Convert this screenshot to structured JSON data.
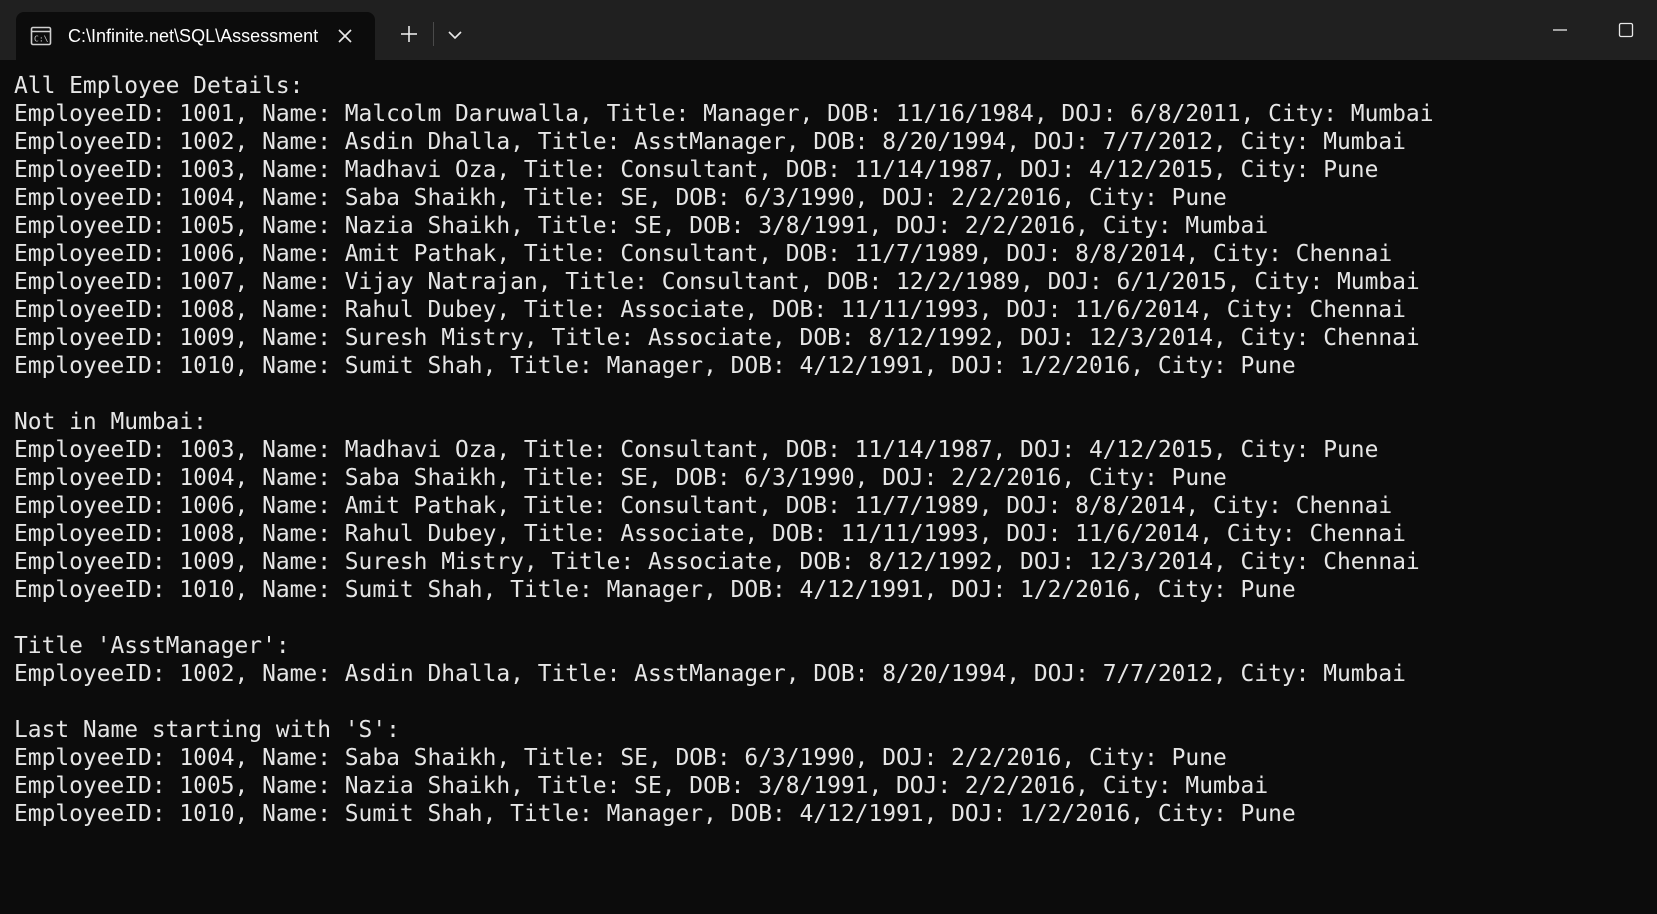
{
  "window": {
    "tab_title": "C:\\Infinite.net\\SQL\\Assessment",
    "tab_icon": "console-icon",
    "new_tab_icon": "plus-icon",
    "dropdown_icon": "chevron-down-icon",
    "minimize_icon": "minimize-icon",
    "maximize_icon": "maximize-icon",
    "close_icon": "close-icon"
  },
  "colors": {
    "background": "#0c0c0c",
    "titlebar": "#202020",
    "text": "#e6e6e6"
  },
  "console": {
    "sections": [
      {
        "heading": "All Employee Details:",
        "lines": [
          "EmployeeID: 1001, Name: Malcolm Daruwalla, Title: Manager, DOB: 11/16/1984, DOJ: 6/8/2011, City: Mumbai",
          "EmployeeID: 1002, Name: Asdin Dhalla, Title: AsstManager, DOB: 8/20/1994, DOJ: 7/7/2012, City: Mumbai",
          "EmployeeID: 1003, Name: Madhavi Oza, Title: Consultant, DOB: 11/14/1987, DOJ: 4/12/2015, City: Pune",
          "EmployeeID: 1004, Name: Saba Shaikh, Title: SE, DOB: 6/3/1990, DOJ: 2/2/2016, City: Pune",
          "EmployeeID: 1005, Name: Nazia Shaikh, Title: SE, DOB: 3/8/1991, DOJ: 2/2/2016, City: Mumbai",
          "EmployeeID: 1006, Name: Amit Pathak, Title: Consultant, DOB: 11/7/1989, DOJ: 8/8/2014, City: Chennai",
          "EmployeeID: 1007, Name: Vijay Natrajan, Title: Consultant, DOB: 12/2/1989, DOJ: 6/1/2015, City: Mumbai",
          "EmployeeID: 1008, Name: Rahul Dubey, Title: Associate, DOB: 11/11/1993, DOJ: 11/6/2014, City: Chennai",
          "EmployeeID: 1009, Name: Suresh Mistry, Title: Associate, DOB: 8/12/1992, DOJ: 12/3/2014, City: Chennai",
          "EmployeeID: 1010, Name: Sumit Shah, Title: Manager, DOB: 4/12/1991, DOJ: 1/2/2016, City: Pune"
        ]
      },
      {
        "heading": "Not in Mumbai:",
        "lines": [
          "EmployeeID: 1003, Name: Madhavi Oza, Title: Consultant, DOB: 11/14/1987, DOJ: 4/12/2015, City: Pune",
          "EmployeeID: 1004, Name: Saba Shaikh, Title: SE, DOB: 6/3/1990, DOJ: 2/2/2016, City: Pune",
          "EmployeeID: 1006, Name: Amit Pathak, Title: Consultant, DOB: 11/7/1989, DOJ: 8/8/2014, City: Chennai",
          "EmployeeID: 1008, Name: Rahul Dubey, Title: Associate, DOB: 11/11/1993, DOJ: 11/6/2014, City: Chennai",
          "EmployeeID: 1009, Name: Suresh Mistry, Title: Associate, DOB: 8/12/1992, DOJ: 12/3/2014, City: Chennai",
          "EmployeeID: 1010, Name: Sumit Shah, Title: Manager, DOB: 4/12/1991, DOJ: 1/2/2016, City: Pune"
        ]
      },
      {
        "heading": "Title 'AsstManager':",
        "lines": [
          "EmployeeID: 1002, Name: Asdin Dhalla, Title: AsstManager, DOB: 8/20/1994, DOJ: 7/7/2012, City: Mumbai"
        ]
      },
      {
        "heading": "Last Name starting with 'S':",
        "lines": [
          "EmployeeID: 1004, Name: Saba Shaikh, Title: SE, DOB: 6/3/1990, DOJ: 2/2/2016, City: Pune",
          "EmployeeID: 1005, Name: Nazia Shaikh, Title: SE, DOB: 3/8/1991, DOJ: 2/2/2016, City: Mumbai",
          "EmployeeID: 1010, Name: Sumit Shah, Title: Manager, DOB: 4/12/1991, DOJ: 1/2/2016, City: Pune"
        ]
      }
    ]
  }
}
